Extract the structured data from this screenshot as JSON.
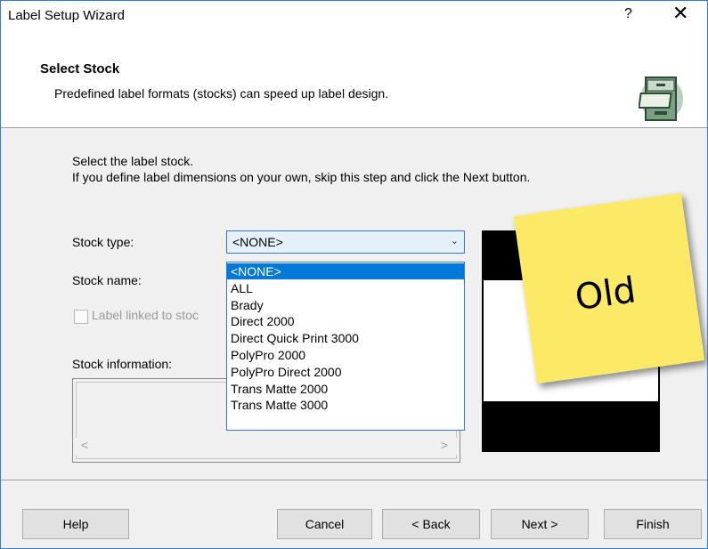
{
  "window": {
    "title": "Label Setup Wizard",
    "help_glyph": "?",
    "close_glyph": "✕"
  },
  "header": {
    "title": "Select Stock",
    "subtitle": "Predefined label formats (stocks) can speed up label design.",
    "icon": "file-cabinet-icon"
  },
  "body": {
    "line1": "Select the label stock.",
    "line2": "If you define label dimensions on your own, skip this step and click the Next button.",
    "stock_type_label": "Stock type:",
    "stock_type_value": "<NONE>",
    "stock_name_label": "Stock name:",
    "linked_label": "Label linked to stoc",
    "stock_info_label": "Stock information:",
    "dropdown_items": [
      "<NONE>",
      "ALL",
      "Brady",
      "Direct 2000",
      "Direct Quick Print 3000",
      "PolyPro 2000",
      "PolyPro Direct 2000",
      "Trans Matte 2000",
      "Trans Matte 3000"
    ],
    "selected_index": 0
  },
  "sticky_note": {
    "text": "Old",
    "color": "#fcea67"
  },
  "buttons": {
    "help": "Help",
    "cancel": "Cancel",
    "back": "< Back",
    "next": "Next >",
    "finish": "Finish"
  },
  "colors": {
    "accent": "#0078d7",
    "combo_border": "#2e79d4"
  }
}
